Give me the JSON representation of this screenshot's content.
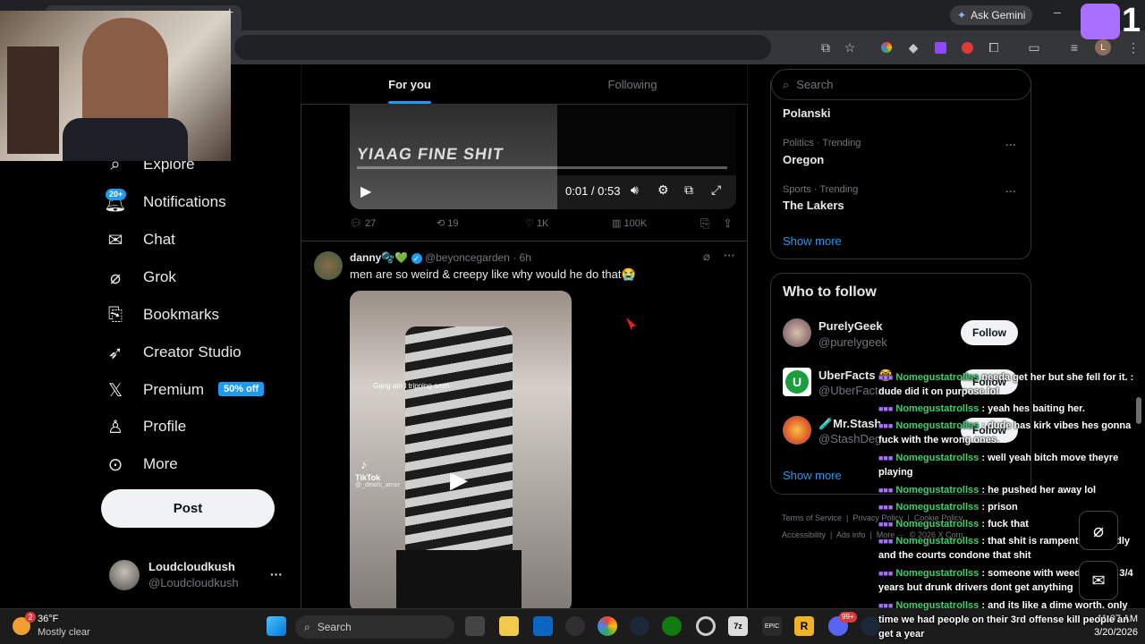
{
  "browser": {
    "ask_gemini": "Ask Gemini",
    "profile_initial": "L"
  },
  "sidebar": {
    "items": [
      {
        "label": "Explore",
        "icon": "search-icon"
      },
      {
        "label": "Notifications",
        "icon": "bell-icon",
        "badge": "20+"
      },
      {
        "label": "Chat",
        "icon": "mail-icon"
      },
      {
        "label": "Grok",
        "icon": "grok-icon"
      },
      {
        "label": "Bookmarks",
        "icon": "bookmark-icon"
      },
      {
        "label": "Creator Studio",
        "icon": "rocket-icon"
      },
      {
        "label": "Premium",
        "icon": "x-logo-icon",
        "badge": "50% off"
      },
      {
        "label": "Profile",
        "icon": "person-icon"
      },
      {
        "label": "More",
        "icon": "more-circle-icon"
      }
    ],
    "post_label": "Post",
    "account": {
      "name": "Loudcloudkush",
      "handle": "@Loudcloudkush",
      "more": "···"
    }
  },
  "tabs": {
    "for_you": "For you",
    "following": "Following"
  },
  "video1": {
    "overlay_text": "YIAAG FINE SHIT",
    "time": "0:01 / 0:53",
    "actions": {
      "replies": "27",
      "reposts": "19",
      "likes": "1K",
      "views": "100K"
    }
  },
  "post2": {
    "name": "danny🫧💚",
    "handle": "@beyoncegarden",
    "time": "· 6h",
    "text": "men are so weird & creepy like why would he do that😭",
    "video_caption": "Gang am I tripping omm",
    "tiktok_label": "TikTok",
    "tiktok_handle": "@_dearlc_amor"
  },
  "right": {
    "search_placeholder": "Search",
    "trends": [
      {
        "category": "",
        "name": "Polanski"
      },
      {
        "category": "Politics · Trending",
        "name": "Oregon"
      },
      {
        "category": "Sports · Trending",
        "name": "The Lakers"
      }
    ],
    "show_more": "Show more",
    "who_to_follow": "Who to follow",
    "follow_label": "Follow",
    "suggestions": [
      {
        "name": "PurelyGeek",
        "handle": "@purelygeek"
      },
      {
        "name": "UberFacts 🤓",
        "handle": "@UberFacts"
      },
      {
        "name": "🧪Mr.Stash",
        "handle": "@StashDeg"
      }
    ],
    "show_more_2": "Show more",
    "footer": [
      "Terms of Service",
      "|",
      "Privacy Policy",
      "|",
      "Cookie Policy",
      "Accessibility",
      "|",
      "Ads info",
      "|",
      "More ···",
      "© 2026 X Corp."
    ]
  },
  "chat": [
    {
      "user": "Nomegustatrollss",
      "msg": ": dude did it on purpose lol",
      "pre": "needa get her but she fell for it."
    },
    {
      "user": "Nomegustatrollss",
      "msg": ": yeah hes baiting her."
    },
    {
      "user": "Nomegustatrollss",
      "msg": ": dude has kirk vibes hes gonna fuck with the wrong ones."
    },
    {
      "user": "Nomegustatrollss",
      "msg": ": well yeah bitch move theyre playing"
    },
    {
      "user": "Nomegustatrollss",
      "msg": ": he pushed her away lol"
    },
    {
      "user": "Nomegustatrollss",
      "msg": ": prison"
    },
    {
      "user": "Nomegustatrollss",
      "msg": ": fuck that"
    },
    {
      "user": "Nomegustatrollss",
      "msg": ": that shit is rampent here sadly and the courts condone that shit"
    },
    {
      "user": "Nomegustatrollss",
      "msg": ": someone with weed will get 3/4 years but drunk drivers dont get anything"
    },
    {
      "user": "Nomegustatrollss",
      "msg": ": and its like a dime worth. only time we had people on their 3rd offense kill people an get a year"
    }
  ],
  "twitch_count": "1",
  "taskbar": {
    "weather_temp": "36°F",
    "weather_desc": "Mostly clear",
    "weather_badge": "2",
    "search": "Search",
    "time": "11:07 AM",
    "date": "3/20/2026",
    "discord_badge": "99+"
  }
}
